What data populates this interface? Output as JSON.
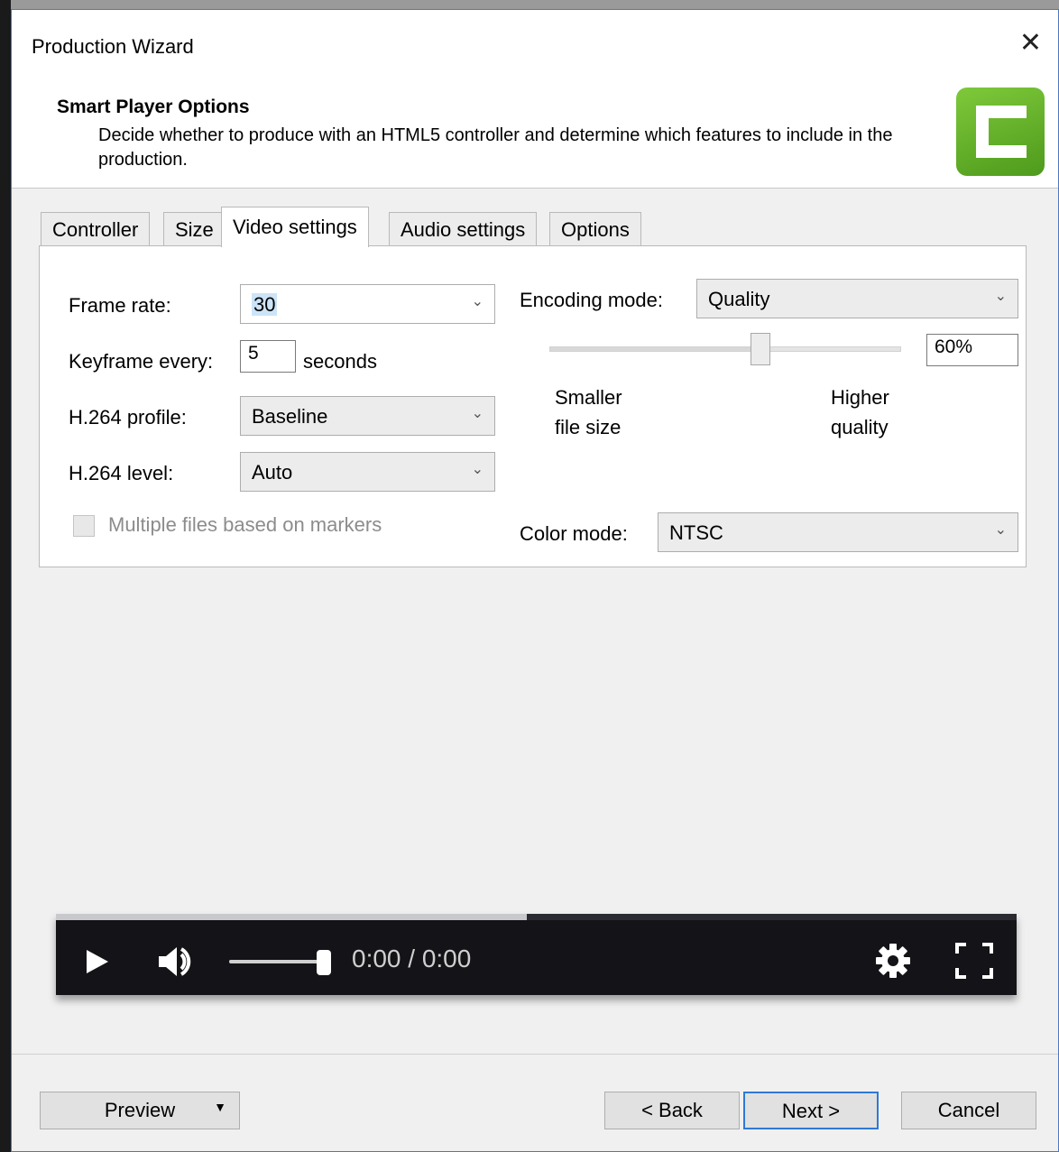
{
  "window": {
    "title": "Production Wizard"
  },
  "header": {
    "title": "Smart Player Options",
    "description": "Decide whether to produce with an HTML5 controller and determine which features to include in the production."
  },
  "tabs": [
    {
      "label": "Controller",
      "active": false
    },
    {
      "label": "Size",
      "active": false
    },
    {
      "label": "Video settings",
      "active": true
    },
    {
      "label": "Audio settings",
      "active": false
    },
    {
      "label": "Options",
      "active": false
    }
  ],
  "video": {
    "frame_rate_label": "Frame rate:",
    "frame_rate_value": "30",
    "keyframe_label": "Keyframe every:",
    "keyframe_value": "5",
    "keyframe_unit": "seconds",
    "profile_label": "H.264 profile:",
    "profile_value": "Baseline",
    "level_label": "H.264 level:",
    "level_value": "Auto",
    "multiple_files_label": "Multiple files based on markers",
    "multiple_files_checked": false,
    "encoding_label": "Encoding mode:",
    "encoding_value": "Quality",
    "quality_percent": 60,
    "quality_text": "60%",
    "smaller_label_1": "Smaller",
    "smaller_label_2": "file size",
    "higher_label_1": "Higher",
    "higher_label_2": "quality",
    "color_label": "Color mode:",
    "color_value": "NTSC"
  },
  "player": {
    "time": "0:00 / 0:00",
    "progress_fraction": 0.49,
    "volume_fraction": 0.95
  },
  "footer": {
    "preview_label": "Preview",
    "back_label": "< Back",
    "next_label": "Next >",
    "cancel_label": "Cancel"
  },
  "colors": {
    "accent": "#2f79d8",
    "logo_green": "#5aa825",
    "player_bg": "#141418"
  }
}
